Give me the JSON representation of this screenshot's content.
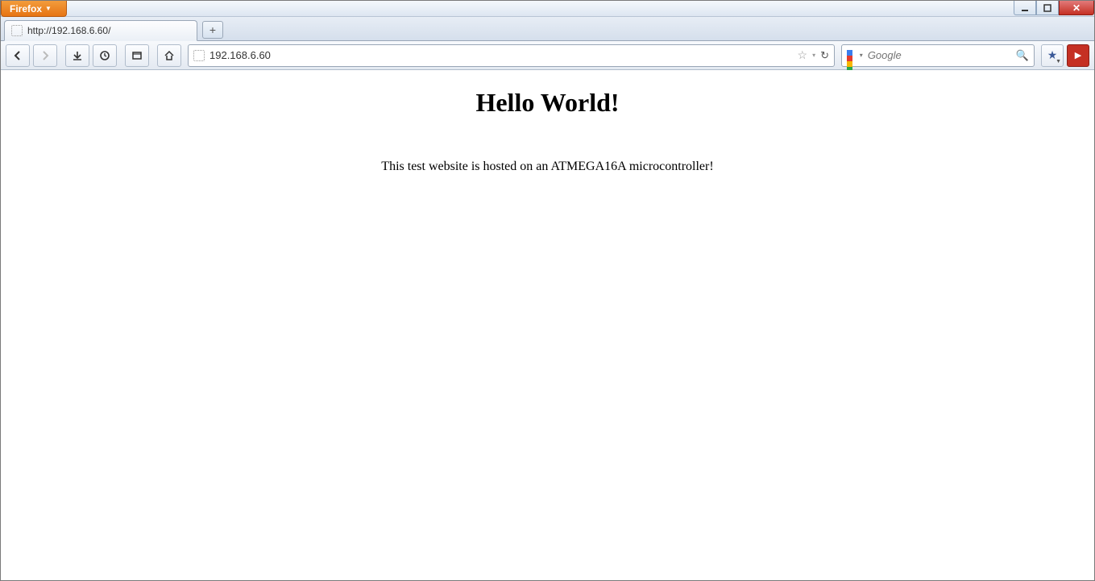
{
  "app": {
    "name": "Firefox"
  },
  "window_controls": {
    "minimize": "min",
    "maximize": "max",
    "close": "close"
  },
  "tabs": [
    {
      "title": "http://192.168.6.60/"
    }
  ],
  "newtab_label": "+",
  "toolbar": {
    "back": "back",
    "forward": "forward",
    "downloads": "downloads",
    "history": "history",
    "fullscreen": "fullscreen",
    "home": "home",
    "bookmark_star": "☆",
    "dropdown": "▾",
    "reload": "↻"
  },
  "urlbar": {
    "value": "192.168.6.60"
  },
  "search": {
    "placeholder": "Google",
    "engine": "google"
  },
  "rightbar": {
    "bookmarks": "bookmarks",
    "abp": "▶"
  },
  "page": {
    "heading": "Hello World!",
    "body": "This test website is hosted on an ATMEGA16A microcontroller!"
  }
}
